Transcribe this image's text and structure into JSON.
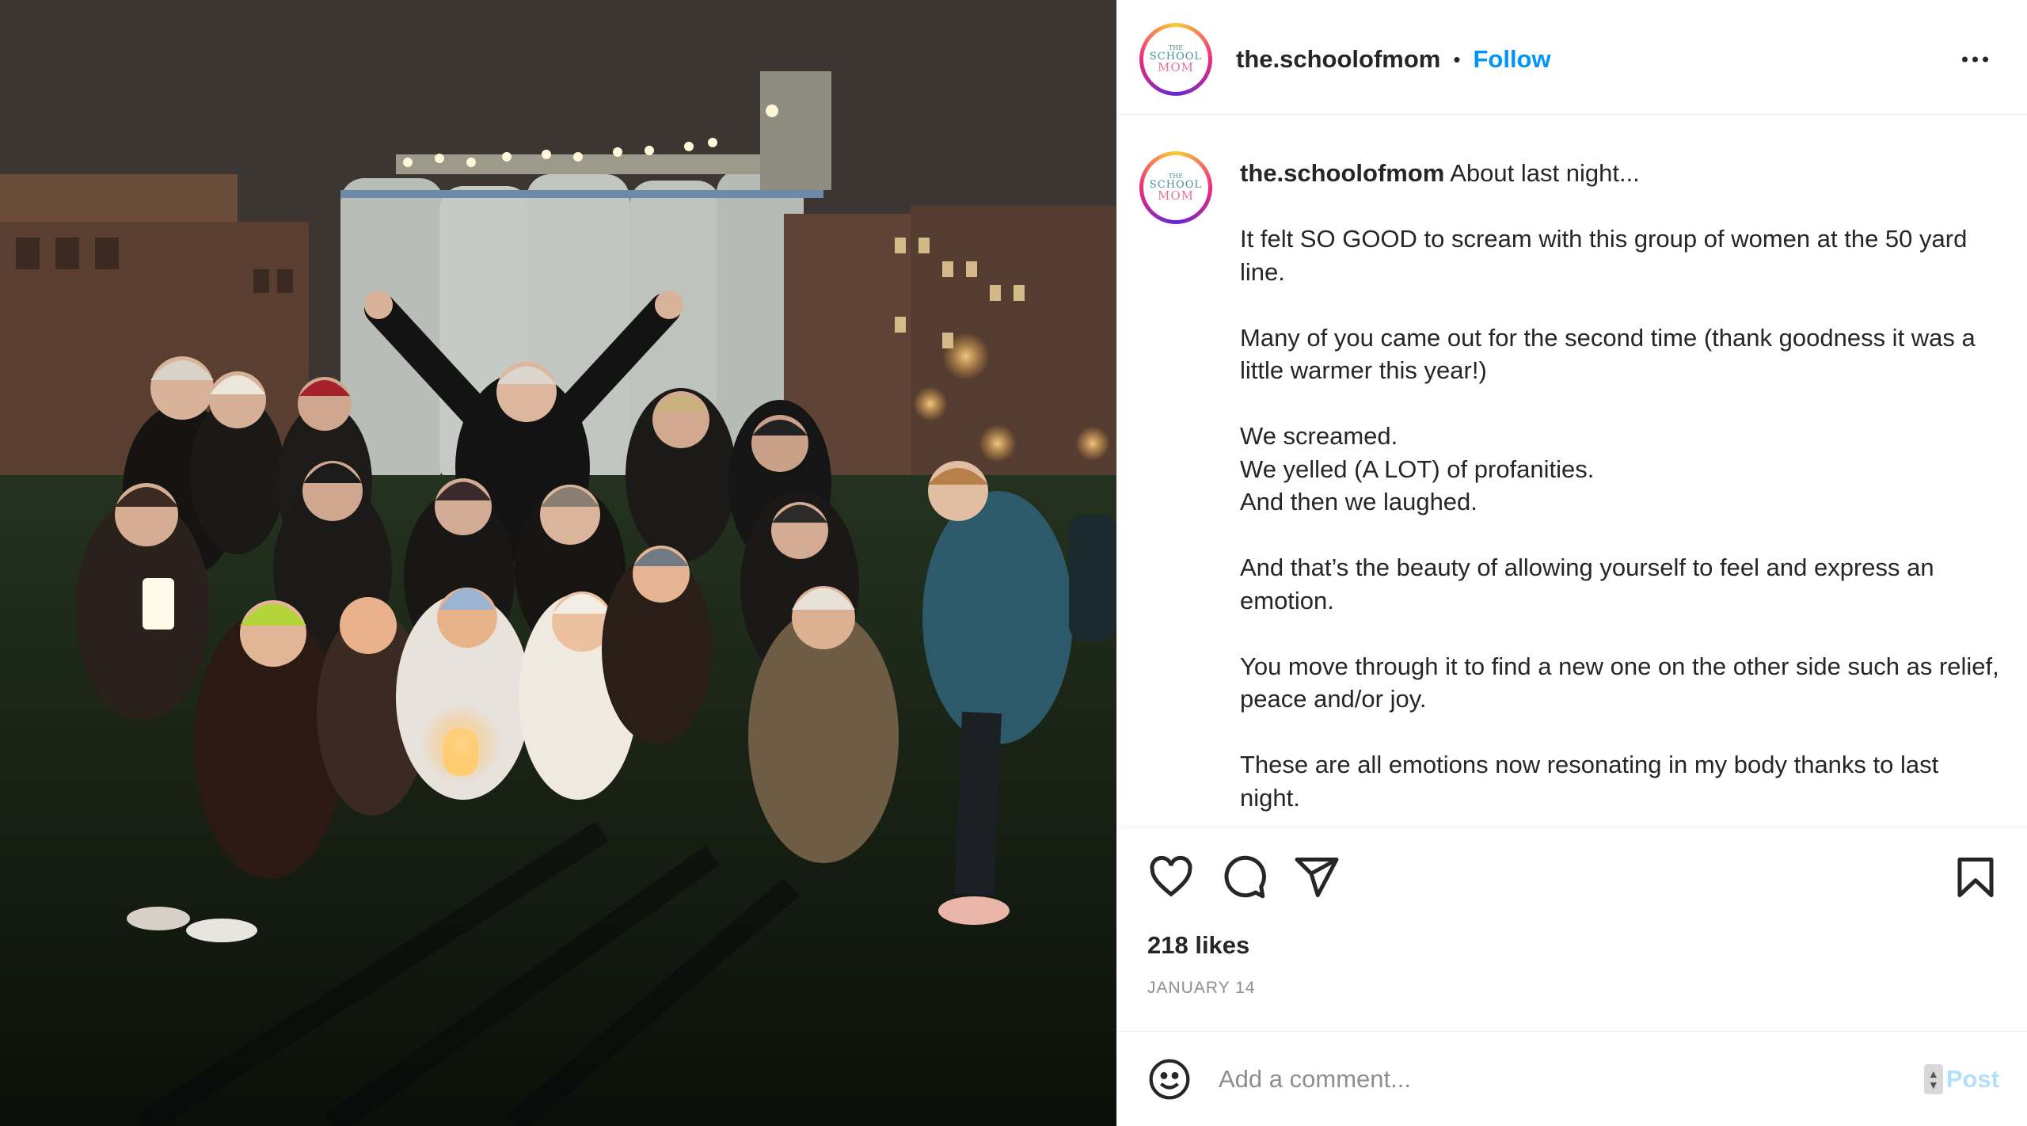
{
  "post": {
    "image_alt": "Group of women posing at night on a field",
    "author": {
      "handle": "the.schoolofmom",
      "avatar_text_top": "THE",
      "avatar_text_mid": "SCHOOL",
      "avatar_text_bottom": "MOM"
    },
    "header": {
      "separator": "•",
      "follow_label": "Follow"
    },
    "caption": {
      "lead": "About last night...",
      "paragraphs": [
        "It felt SO GOOD to scream with this group of women at the 50 yard line.",
        "Many of you came out for the second time (thank goodness it was a little warmer this year!)",
        "We screamed.\nWe yelled (A LOT) of profanities.\nAnd then we laughed.",
        "And that’s the beauty of allowing yourself to feel and express an emotion.",
        "You move through it to find a new one on the other side such as relief, peace and/or joy.",
        "These are all emotions now resonating in my body thanks to last night."
      ]
    },
    "actions": {
      "like_icon": "heart-icon",
      "comment_icon": "comment-icon",
      "share_icon": "share-icon",
      "save_icon": "bookmark-icon"
    },
    "likes": "218 likes",
    "date": "January 14",
    "comment": {
      "placeholder": "Add a comment...",
      "post_label": "Post",
      "emoji_icon": "smiley-icon"
    },
    "colors": {
      "follow": "#0095f6",
      "post_disabled": "#b2dffc",
      "muted": "#8e8e8e",
      "text": "#262626"
    }
  }
}
